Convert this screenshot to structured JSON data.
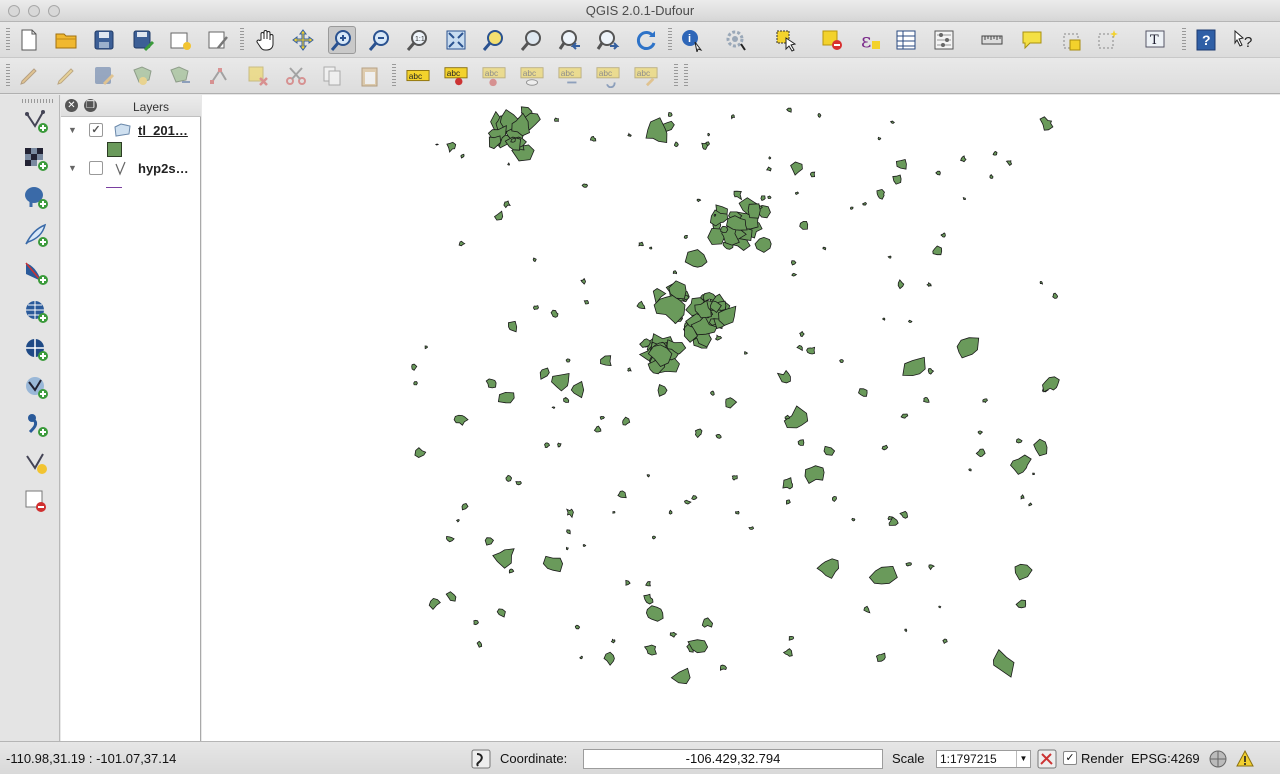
{
  "window": {
    "title": "QGIS 2.0.1-Dufour",
    "traffic_lights": [
      "close",
      "minimize",
      "zoom"
    ]
  },
  "toolbar1": {
    "icons": [
      "new-project-icon",
      "open-project-icon",
      "save-project-icon",
      "save-as-icon",
      "new-print-composer-icon",
      "composer-manager-icon",
      "pan-icon",
      "pan-to-selection-icon",
      "zoom-in-icon",
      "zoom-out-icon",
      "zoom-actual-icon",
      "zoom-full-icon",
      "zoom-to-selection-icon",
      "zoom-to-layer-icon",
      "zoom-last-icon",
      "zoom-next-icon",
      "refresh-icon",
      "identify-icon",
      "run-action-icon",
      "select-icon",
      "deselect-icon",
      "select-by-expression-icon",
      "expression-icon",
      "attribute-table-icon",
      "statistics-icon",
      "measure-icon",
      "map-tips-icon",
      "new-bookmark-icon",
      "show-bookmarks-icon",
      "text-annotation-icon",
      "help-icon",
      "whats-this-icon"
    ]
  },
  "toolbar2": {
    "icons": [
      "current-edits-icon",
      "toggle-editing-icon",
      "save-edits-icon",
      "add-feature-icon",
      "move-feature-icon",
      "node-tool-icon",
      "delete-selected-icon",
      "cut-features-icon",
      "copy-features-icon",
      "paste-features-icon",
      "label-icon",
      "label-pin-icon",
      "label-highlight-icon",
      "label-show-hide-icon",
      "label-move-icon",
      "label-rotate-icon",
      "label-change-icon"
    ],
    "label_glyph": "abc"
  },
  "left_toolbar": {
    "icons": [
      "add-vector-layer-icon",
      "add-raster-layer-icon",
      "add-postgis-layer-icon",
      "add-spatialite-layer-icon",
      "add-mssql-layer-icon",
      "add-wms-layer-icon",
      "add-wcs-layer-icon",
      "add-wfs-layer-icon",
      "add-delimited-text-icon",
      "new-shapefile-icon",
      "remove-layer-icon"
    ]
  },
  "layers_panel": {
    "title": "Layers",
    "layers": [
      {
        "name": "tl_201…",
        "checked": true,
        "expanded": true,
        "symbol_color": "#6a9a5b"
      },
      {
        "name": "hyp2s…",
        "checked": false,
        "expanded": true,
        "symbol_color": "#7a3fa0"
      }
    ]
  },
  "map": {
    "feature_fill": "#6a9a5b",
    "feature_stroke": "#1a1a1a",
    "background": "#ffffff"
  },
  "status": {
    "extent": "-110.98,31.19 : -101.07,37.14",
    "coordinate_label": "Coordinate:",
    "coordinate_value": "-106.429,32.794",
    "scale_label": "Scale",
    "scale_value": "1:1797215",
    "render_label": "Render",
    "render_checked": true,
    "crs": "EPSG:4269"
  }
}
